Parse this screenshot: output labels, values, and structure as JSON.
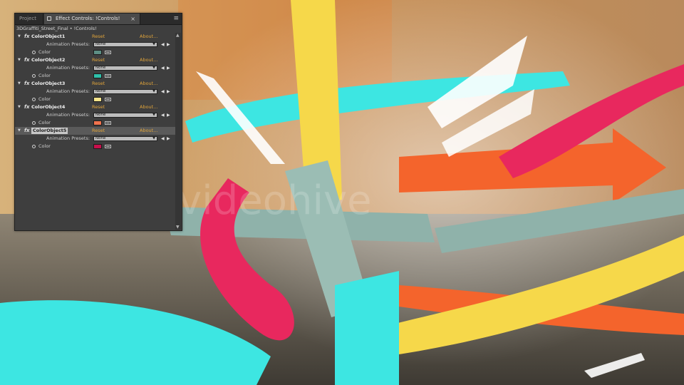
{
  "panel": {
    "tabs": {
      "project": "Project",
      "effect_controls": "Effect Controls: !Controls!"
    },
    "breadcrumb": "3DGraffiti_Street_Final • !Controls!"
  },
  "effects": [
    {
      "name": "ColorObject1",
      "reset": "Reset",
      "about": "About...",
      "presets_label": "Animation Presets:",
      "preset": "None",
      "color_label": "Color",
      "color": "#5d8e84"
    },
    {
      "name": "ColorObject2",
      "reset": "Reset",
      "about": "About...",
      "presets_label": "Animation Presets:",
      "preset": "None",
      "color_label": "Color",
      "color": "#2fc0aa"
    },
    {
      "name": "ColorObject3",
      "reset": "Reset",
      "about": "About...",
      "presets_label": "Animation Presets:",
      "preset": "None",
      "color_label": "Color",
      "color": "#f4e48a"
    },
    {
      "name": "ColorObject4",
      "reset": "Reset",
      "about": "About...",
      "presets_label": "Animation Presets:",
      "preset": "None",
      "color_label": "Color",
      "color": "#f0734e"
    },
    {
      "name": "ColorObject5",
      "reset": "Reset",
      "about": "About...",
      "presets_label": "Animation Presets:",
      "preset": "None",
      "color_label": "Color",
      "color": "#c8104c"
    }
  ],
  "scene": {
    "watermark": "videohive",
    "colors": {
      "cyan": "#3de6e2",
      "magenta": "#e8285e",
      "yellow": "#f6d84a",
      "orange": "#f4642c",
      "slate": "#8fb2aa",
      "ground": "#6b6355",
      "wall": "#c9a06a"
    }
  }
}
